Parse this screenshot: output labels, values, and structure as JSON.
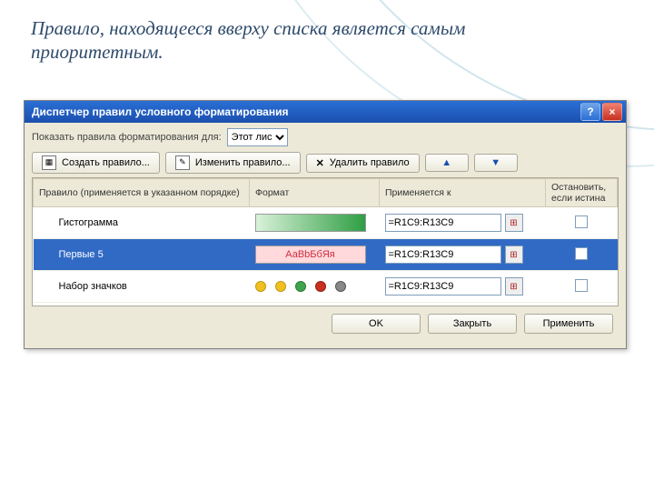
{
  "slide": {
    "caption": "Правило, находящееся вверху списка является самым приоритетным."
  },
  "dialog": {
    "title": "Диспетчер правил условного форматирования",
    "show_for_label": "Показать правила форматирования для:",
    "show_for_value": "Этот лис",
    "buttons": {
      "create": "Создать правило...",
      "edit": "Изменить правило...",
      "delete": "Удалить правило"
    },
    "columns": {
      "rule": "Правило (применяется в указанном порядке)",
      "format": "Формат",
      "applies": "Применяется к",
      "stop": "Остановить, если истина"
    },
    "rules": [
      {
        "name": "Гистограмма",
        "format_preview": "gradient",
        "format_text": "",
        "applies": "=R1C9:R13C9",
        "stop": false,
        "selected": false
      },
      {
        "name": "Первые 5",
        "format_preview": "text",
        "format_text": "АаВbБбЯя",
        "applies": "=R1C9:R13C9",
        "stop": false,
        "selected": true
      },
      {
        "name": "Набор значков",
        "format_preview": "icons",
        "format_text": "",
        "applies": "=R1C9:R13C9",
        "stop": false,
        "selected": false
      }
    ],
    "footer": {
      "ok": "OK",
      "close": "Закрыть",
      "apply": "Применить"
    }
  }
}
